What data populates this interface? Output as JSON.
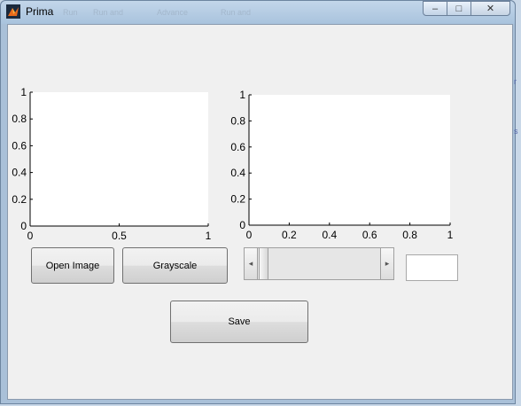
{
  "window": {
    "title": "Prima"
  },
  "background_ghost_labels": [
    "Run",
    "Run and",
    "Advance",
    "Run and"
  ],
  "title_controls": {
    "minimize": "‒",
    "maximize": "□",
    "close": "✕"
  },
  "axes1": {
    "y_ticks": [
      "0",
      "0.2",
      "0.4",
      "0.6",
      "0.8",
      "1"
    ],
    "x_ticks": [
      "0",
      "0.5",
      "1"
    ]
  },
  "axes2": {
    "y_ticks": [
      "0",
      "0.2",
      "0.4",
      "0.6",
      "0.8",
      "1"
    ],
    "x_ticks": [
      "0",
      "0.2",
      "0.4",
      "0.6",
      "0.8",
      "1"
    ]
  },
  "buttons": {
    "open_image": "Open Image",
    "grayscale": "Grayscale",
    "save": "Save"
  },
  "slider": {
    "left_arrow": "◂",
    "right_arrow": "▸",
    "value": 0
  },
  "edit_value": "",
  "side_glyphs": [
    "r",
    "s"
  ]
}
